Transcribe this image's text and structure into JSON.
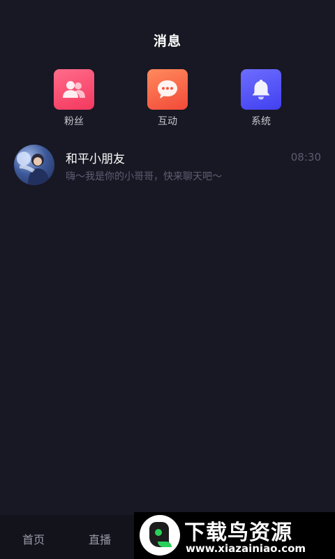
{
  "header": {
    "title": "消息"
  },
  "categories": [
    {
      "label": "粉丝",
      "icon": "fans-icon"
    },
    {
      "label": "互动",
      "icon": "chat-bubble-icon"
    },
    {
      "label": "系统",
      "icon": "bell-icon"
    }
  ],
  "messages": [
    {
      "name": "和平小朋友",
      "time": "08:30",
      "preview": "嗨～我是你的小哥哥，快来聊天吧～"
    }
  ],
  "tabbar": {
    "home_label": "首页",
    "live_label": "直播"
  },
  "watermark": {
    "title": "下载鸟资源",
    "url": "www.xiazainiao.com"
  },
  "colors": {
    "background": "#181824",
    "fans_accent": "#f4385f",
    "interact_accent": "#f24a39",
    "system_accent": "#4140f0"
  }
}
